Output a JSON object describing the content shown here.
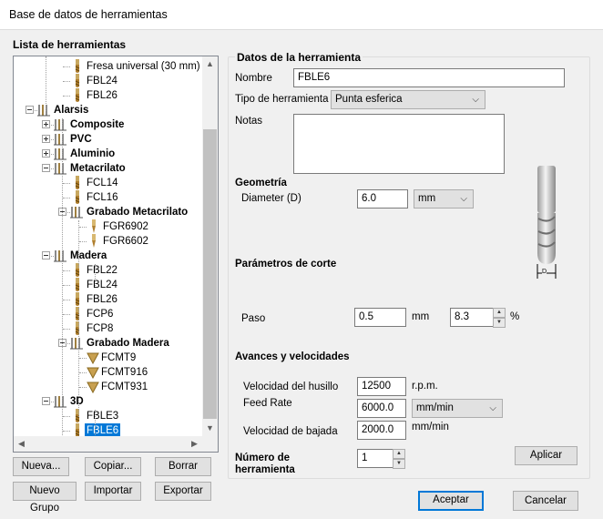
{
  "window": {
    "title": "Base de datos de herramientas"
  },
  "tree_panel": {
    "title": "Lista de herramientas",
    "items": [
      {
        "label": "Fresa universal (30 mm)",
        "kind": "tool",
        "depth": 3
      },
      {
        "label": "FBL24",
        "kind": "tool",
        "depth": 3
      },
      {
        "label": "FBL26",
        "kind": "tool",
        "depth": 3
      },
      {
        "label": "Alarsis",
        "kind": "group",
        "depth": 1,
        "expanded": true
      },
      {
        "label": "Composite",
        "kind": "group",
        "depth": 2,
        "expanded": false
      },
      {
        "label": "PVC",
        "kind": "group",
        "depth": 2,
        "expanded": false
      },
      {
        "label": "Aluminio",
        "kind": "group",
        "depth": 2,
        "expanded": false
      },
      {
        "label": "Metacrilato",
        "kind": "group",
        "depth": 2,
        "expanded": true
      },
      {
        "label": "FCL14",
        "kind": "tool",
        "depth": 3
      },
      {
        "label": "FCL16",
        "kind": "tool",
        "depth": 3
      },
      {
        "label": "Grabado Metacrilato",
        "kind": "group",
        "depth": 3,
        "expanded": true
      },
      {
        "label": "FGR6902",
        "kind": "tool2",
        "depth": 4
      },
      {
        "label": "FGR6602",
        "kind": "tool2",
        "depth": 4
      },
      {
        "label": "Madera",
        "kind": "group",
        "depth": 2,
        "expanded": true
      },
      {
        "label": "FBL22",
        "kind": "tool",
        "depth": 3
      },
      {
        "label": "FBL24",
        "kind": "tool",
        "depth": 3
      },
      {
        "label": "FBL26",
        "kind": "tool",
        "depth": 3
      },
      {
        "label": "FCP6",
        "kind": "tool",
        "depth": 3
      },
      {
        "label": "FCP8",
        "kind": "tool",
        "depth": 3
      },
      {
        "label": "Grabado Madera",
        "kind": "group",
        "depth": 3,
        "expanded": true
      },
      {
        "label": "FCMT9",
        "kind": "cone",
        "depth": 4
      },
      {
        "label": "FCMT916",
        "kind": "cone",
        "depth": 4
      },
      {
        "label": "FCMT931",
        "kind": "cone",
        "depth": 4
      },
      {
        "label": "3D",
        "kind": "group",
        "depth": 2,
        "expanded": true
      },
      {
        "label": "FBLE3",
        "kind": "tool",
        "depth": 3
      },
      {
        "label": "FBLE6",
        "kind": "tool",
        "depth": 3,
        "selected": true
      }
    ],
    "buttons": {
      "new": "Nueva...",
      "copy": "Copiar...",
      "delete": "Borrar",
      "new_group": "Nuevo Grupo",
      "import": "Importar",
      "export": "Exportar"
    }
  },
  "details": {
    "section_title": "Datos de la herramienta",
    "name": {
      "label": "Nombre",
      "value": "FBLE6"
    },
    "tool_type": {
      "label": "Tipo de herramienta",
      "value": "Punta esferica"
    },
    "notes": {
      "label": "Notas",
      "value": ""
    },
    "geometry": {
      "title": "Geometría",
      "diameter": {
        "label": "Diameter (D)",
        "value": "6.0",
        "unit": "mm"
      },
      "diagram_label": "D"
    },
    "cutting": {
      "title": "Parámetros de corte",
      "step": {
        "label": "Paso",
        "value": "0.5",
        "unit": "mm",
        "percent": "8.3",
        "percent_unit": "%"
      }
    },
    "feeds": {
      "title": "Avances y velocidades",
      "spindle": {
        "label": "Velocidad del husillo",
        "value": "12500",
        "unit": "r.p.m."
      },
      "feed_rate": {
        "label": "Feed Rate",
        "value": "6000.0",
        "unit": "mm/min"
      },
      "plunge": {
        "label": "Velocidad de bajada",
        "value": "2000.0",
        "unit": "mm/min"
      }
    },
    "tool_number": {
      "label": "Número de herramienta",
      "value": "1"
    },
    "apply_button": "Aplicar"
  },
  "footer": {
    "accept": "Aceptar",
    "cancel": "Cancelar"
  }
}
